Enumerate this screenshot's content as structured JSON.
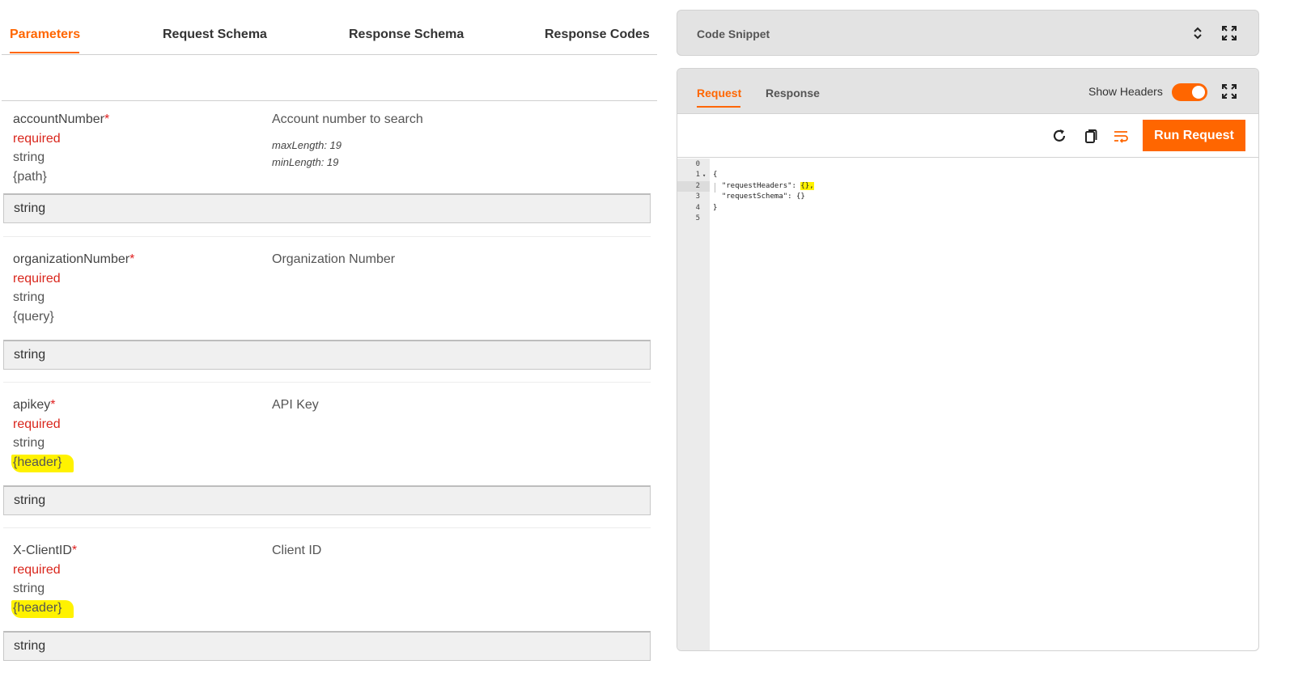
{
  "tabs": [
    {
      "label": "Parameters",
      "active": true
    },
    {
      "label": "Request Schema",
      "active": false
    },
    {
      "label": "Response Schema",
      "active": false
    },
    {
      "label": "Response Codes",
      "active": false
    }
  ],
  "params": [
    {
      "name": "accountNumber",
      "star": "*",
      "required": "required",
      "type": "string",
      "location": "{path}",
      "description": "Account number to search",
      "constraint1": "maxLength: 19",
      "constraint2": "minLength: 19",
      "value": "string",
      "highlighted": false
    },
    {
      "name": "organizationNumber",
      "star": "*",
      "required": "required",
      "type": "string",
      "location": "{query}",
      "description": "Organization Number",
      "constraint1": "",
      "constraint2": "",
      "value": "string",
      "highlighted": false
    },
    {
      "name": "apikey",
      "star": "*",
      "required": "required",
      "type": "string",
      "location": "{header}",
      "description": "API Key",
      "constraint1": "",
      "constraint2": "",
      "value": "string",
      "highlighted": true
    },
    {
      "name": "X-ClientID",
      "star": "*",
      "required": "required",
      "type": "string",
      "location": "{header}",
      "description": "Client ID",
      "constraint1": "",
      "constraint2": "",
      "value": "string",
      "highlighted": true
    }
  ],
  "snippet": {
    "title": "Code Snippet",
    "icons": [
      "expand-collapse-icon",
      "fullscreen-icon"
    ]
  },
  "request_panel": {
    "tabs": [
      {
        "label": "Request",
        "active": true
      },
      {
        "label": "Response",
        "active": false
      }
    ],
    "show_headers_label": "Show Headers",
    "show_headers_on": true,
    "toolbar_icons": [
      "refresh-icon",
      "copy-icon",
      "wrap-icon"
    ],
    "run_label": "Run Request",
    "accent": "#ff6600"
  },
  "editor": {
    "lines": [
      {
        "n": "0",
        "text": ""
      },
      {
        "n": "1",
        "text": "{"
      },
      {
        "n": "2",
        "text": "  \"requestHeaders\": ",
        "hl": "{},"
      },
      {
        "n": "3",
        "text": "  \"requestSchema\": {}"
      },
      {
        "n": "4",
        "text": "}"
      },
      {
        "n": "5",
        "text": ""
      }
    ]
  }
}
